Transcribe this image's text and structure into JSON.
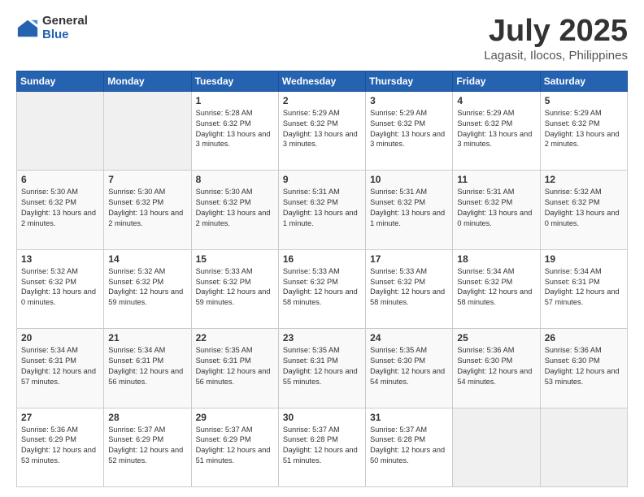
{
  "logo": {
    "general": "General",
    "blue": "Blue"
  },
  "title": "July 2025",
  "subtitle": "Lagasit, Ilocos, Philippines",
  "header_days": [
    "Sunday",
    "Monday",
    "Tuesday",
    "Wednesday",
    "Thursday",
    "Friday",
    "Saturday"
  ],
  "weeks": [
    [
      {
        "day": "",
        "info": ""
      },
      {
        "day": "",
        "info": ""
      },
      {
        "day": "1",
        "info": "Sunrise: 5:28 AM\nSunset: 6:32 PM\nDaylight: 13 hours and 3 minutes."
      },
      {
        "day": "2",
        "info": "Sunrise: 5:29 AM\nSunset: 6:32 PM\nDaylight: 13 hours and 3 minutes."
      },
      {
        "day": "3",
        "info": "Sunrise: 5:29 AM\nSunset: 6:32 PM\nDaylight: 13 hours and 3 minutes."
      },
      {
        "day": "4",
        "info": "Sunrise: 5:29 AM\nSunset: 6:32 PM\nDaylight: 13 hours and 3 minutes."
      },
      {
        "day": "5",
        "info": "Sunrise: 5:29 AM\nSunset: 6:32 PM\nDaylight: 13 hours and 2 minutes."
      }
    ],
    [
      {
        "day": "6",
        "info": "Sunrise: 5:30 AM\nSunset: 6:32 PM\nDaylight: 13 hours and 2 minutes."
      },
      {
        "day": "7",
        "info": "Sunrise: 5:30 AM\nSunset: 6:32 PM\nDaylight: 13 hours and 2 minutes."
      },
      {
        "day": "8",
        "info": "Sunrise: 5:30 AM\nSunset: 6:32 PM\nDaylight: 13 hours and 2 minutes."
      },
      {
        "day": "9",
        "info": "Sunrise: 5:31 AM\nSunset: 6:32 PM\nDaylight: 13 hours and 1 minute."
      },
      {
        "day": "10",
        "info": "Sunrise: 5:31 AM\nSunset: 6:32 PM\nDaylight: 13 hours and 1 minute."
      },
      {
        "day": "11",
        "info": "Sunrise: 5:31 AM\nSunset: 6:32 PM\nDaylight: 13 hours and 0 minutes."
      },
      {
        "day": "12",
        "info": "Sunrise: 5:32 AM\nSunset: 6:32 PM\nDaylight: 13 hours and 0 minutes."
      }
    ],
    [
      {
        "day": "13",
        "info": "Sunrise: 5:32 AM\nSunset: 6:32 PM\nDaylight: 13 hours and 0 minutes."
      },
      {
        "day": "14",
        "info": "Sunrise: 5:32 AM\nSunset: 6:32 PM\nDaylight: 12 hours and 59 minutes."
      },
      {
        "day": "15",
        "info": "Sunrise: 5:33 AM\nSunset: 6:32 PM\nDaylight: 12 hours and 59 minutes."
      },
      {
        "day": "16",
        "info": "Sunrise: 5:33 AM\nSunset: 6:32 PM\nDaylight: 12 hours and 58 minutes."
      },
      {
        "day": "17",
        "info": "Sunrise: 5:33 AM\nSunset: 6:32 PM\nDaylight: 12 hours and 58 minutes."
      },
      {
        "day": "18",
        "info": "Sunrise: 5:34 AM\nSunset: 6:32 PM\nDaylight: 12 hours and 58 minutes."
      },
      {
        "day": "19",
        "info": "Sunrise: 5:34 AM\nSunset: 6:31 PM\nDaylight: 12 hours and 57 minutes."
      }
    ],
    [
      {
        "day": "20",
        "info": "Sunrise: 5:34 AM\nSunset: 6:31 PM\nDaylight: 12 hours and 57 minutes."
      },
      {
        "day": "21",
        "info": "Sunrise: 5:34 AM\nSunset: 6:31 PM\nDaylight: 12 hours and 56 minutes."
      },
      {
        "day": "22",
        "info": "Sunrise: 5:35 AM\nSunset: 6:31 PM\nDaylight: 12 hours and 56 minutes."
      },
      {
        "day": "23",
        "info": "Sunrise: 5:35 AM\nSunset: 6:31 PM\nDaylight: 12 hours and 55 minutes."
      },
      {
        "day": "24",
        "info": "Sunrise: 5:35 AM\nSunset: 6:30 PM\nDaylight: 12 hours and 54 minutes."
      },
      {
        "day": "25",
        "info": "Sunrise: 5:36 AM\nSunset: 6:30 PM\nDaylight: 12 hours and 54 minutes."
      },
      {
        "day": "26",
        "info": "Sunrise: 5:36 AM\nSunset: 6:30 PM\nDaylight: 12 hours and 53 minutes."
      }
    ],
    [
      {
        "day": "27",
        "info": "Sunrise: 5:36 AM\nSunset: 6:29 PM\nDaylight: 12 hours and 53 minutes."
      },
      {
        "day": "28",
        "info": "Sunrise: 5:37 AM\nSunset: 6:29 PM\nDaylight: 12 hours and 52 minutes."
      },
      {
        "day": "29",
        "info": "Sunrise: 5:37 AM\nSunset: 6:29 PM\nDaylight: 12 hours and 51 minutes."
      },
      {
        "day": "30",
        "info": "Sunrise: 5:37 AM\nSunset: 6:28 PM\nDaylight: 12 hours and 51 minutes."
      },
      {
        "day": "31",
        "info": "Sunrise: 5:37 AM\nSunset: 6:28 PM\nDaylight: 12 hours and 50 minutes."
      },
      {
        "day": "",
        "info": ""
      },
      {
        "day": "",
        "info": ""
      }
    ]
  ]
}
